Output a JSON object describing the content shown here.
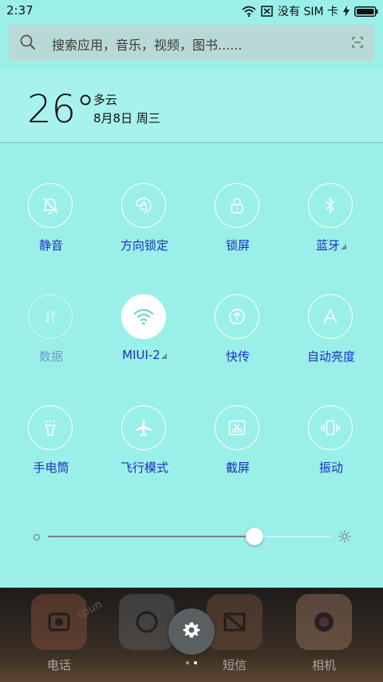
{
  "status_bar": {
    "time": "2:37",
    "carrier": "没有 SIM 卡"
  },
  "search": {
    "placeholder": "搜索应用，音乐，视频，图书......"
  },
  "weather": {
    "temperature": "26°",
    "condition": "多云",
    "date": "8月8日 周三"
  },
  "toggles": [
    {
      "label": "静音",
      "icon": "bell-off-icon",
      "state": "off"
    },
    {
      "label": "方向锁定",
      "icon": "rotation-lock-icon",
      "state": "off"
    },
    {
      "label": "锁屏",
      "icon": "lock-icon",
      "state": "off"
    },
    {
      "label": "蓝牙",
      "icon": "bluetooth-icon",
      "state": "off"
    },
    {
      "label": "数据",
      "icon": "mobile-data-icon",
      "state": "disabled"
    },
    {
      "label": "MIUI-2",
      "icon": "wifi-icon",
      "state": "on"
    },
    {
      "label": "快传",
      "icon": "quick-transfer-icon",
      "state": "off"
    },
    {
      "label": "自动亮度",
      "icon": "auto-brightness-icon",
      "state": "off"
    },
    {
      "label": "手电筒",
      "icon": "flashlight-icon",
      "state": "off"
    },
    {
      "label": "飞行模式",
      "icon": "airplane-icon",
      "state": "off"
    },
    {
      "label": "截屏",
      "icon": "screenshot-icon",
      "state": "off"
    },
    {
      "label": "振动",
      "icon": "vibrate-icon",
      "state": "off"
    }
  ],
  "brightness": {
    "level": 0.73
  },
  "dock": {
    "apps": [
      {
        "label": "电话",
        "icon": "phone-icon"
      },
      {
        "label": "",
        "icon": "browser-icon"
      },
      {
        "label": "短信",
        "icon": "message-icon"
      },
      {
        "label": "相机",
        "icon": "camera-icon"
      }
    ],
    "decor_text": "spun"
  },
  "colors": {
    "background": "#9BEFE9",
    "label": "#1a2fc4",
    "active_circle": "#ffffff"
  }
}
